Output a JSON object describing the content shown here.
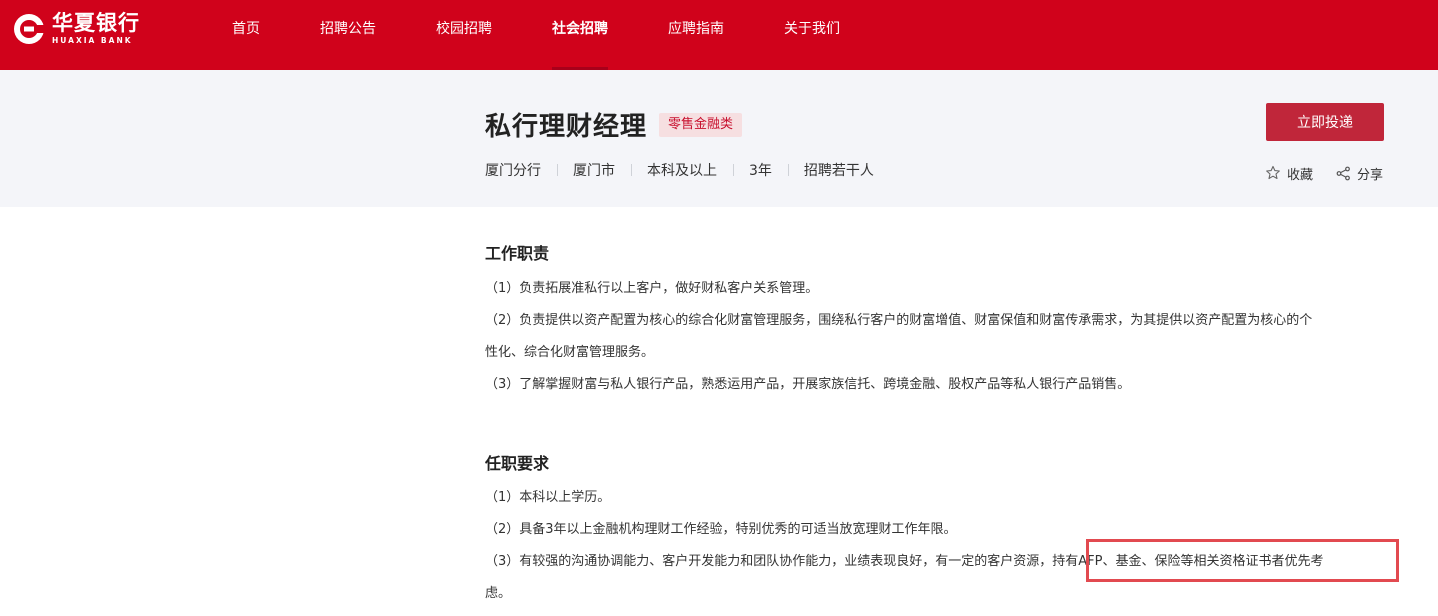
{
  "brand": {
    "name_cn": "华夏银行",
    "name_en": "HUAXIA BANK",
    "color": "#d0021b"
  },
  "nav": {
    "items": [
      {
        "label": "首页"
      },
      {
        "label": "招聘公告"
      },
      {
        "label": "校园招聘"
      },
      {
        "label": "社会招聘",
        "active": true
      },
      {
        "label": "应聘指南"
      },
      {
        "label": "关于我们"
      }
    ]
  },
  "job": {
    "title": "私行理财经理",
    "tag": "零售金融类",
    "meta": [
      "厦门分行",
      "厦门市",
      "本科及以上",
      "3年",
      "招聘若干人"
    ],
    "apply_label": "立即投递",
    "favorite_label": "收藏",
    "share_label": "分享"
  },
  "duties": {
    "title": "工作职责",
    "lines": [
      "（1）负责拓展准私行以上客户，做好财私客户关系管理。",
      "（2）负责提供以资产配置为核心的综合化财富管理服务，围绕私行客户的财富增值、财富保值和财富传承需求，为其提供以资产配置为核心的个",
      "性化、综合化财富管理服务。",
      "（3）了解掌握财富与私人银行产品，熟悉运用产品，开展家族信托、跨境金融、股权产品等私人银行产品销售。"
    ]
  },
  "requirements": {
    "title": "任职要求",
    "lines": [
      "（1）本科以上学历。",
      "（2）具备3年以上金融机构理财工作经验，特别优秀的可适当放宽理财工作年限。",
      "（3）有较强的沟通协调能力、客户开发能力和团队协作能力，业绩表现良好，有一定的客户资源，持有AFP、基金、保险等相关资格证书者优先考",
      "虑。"
    ]
  },
  "colors": {
    "accent": "#c0263a",
    "header_band": "#f4f5f9",
    "tag_bg": "#f6dfe1",
    "highlight": "#e24a50"
  }
}
